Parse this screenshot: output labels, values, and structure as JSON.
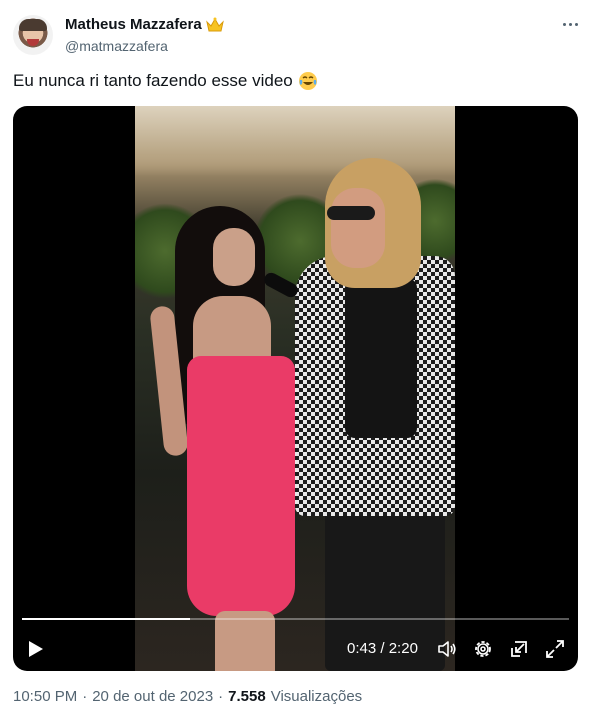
{
  "author": {
    "name": "Matheus Mazzafera",
    "handle": "@matmazzafera",
    "avatar_icon": "profile-photo",
    "badge_icon": "crown-emoji"
  },
  "tweet": {
    "text": "Eu nunca ri tanto fazendo esse video",
    "emoji_icon": "face-with-tears-of-joy-emoji"
  },
  "video": {
    "current_time": "0:43",
    "separator": "/",
    "duration": "2:20",
    "progress_fraction": 0.307,
    "controls": [
      "play-icon",
      "volume-icon",
      "settings-icon",
      "pop-out-icon",
      "fullscreen-icon"
    ]
  },
  "meta": {
    "time": "10:50 PM",
    "dot1": "·",
    "date": "20 de out de 2023",
    "dot2": "·",
    "views_count": "7.558",
    "views_label": "Visualizações"
  },
  "colors": {
    "text_primary": "#0f1419",
    "text_secondary": "#536471",
    "dress": "#ea3b67"
  }
}
